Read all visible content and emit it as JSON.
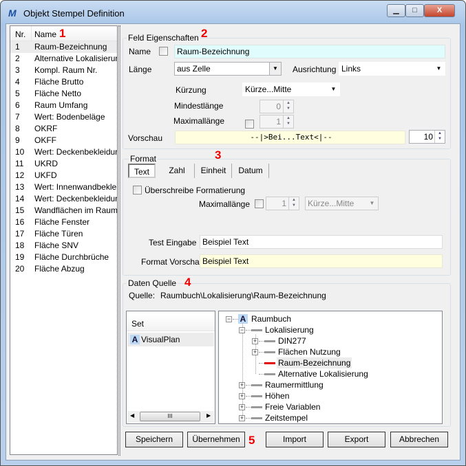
{
  "window": {
    "title": "Objekt Stempel Definition",
    "controls": [
      "minimize",
      "maximize",
      "close"
    ]
  },
  "list": {
    "col_nr": "Nr.",
    "col_name": "Name",
    "items": [
      {
        "nr": "1",
        "name": "Raum-Bezeichnung"
      },
      {
        "nr": "2",
        "name": "Alternative Lokalisierung"
      },
      {
        "nr": "3",
        "name": "Kompl. Raum Nr."
      },
      {
        "nr": "4",
        "name": "Fläche Brutto"
      },
      {
        "nr": "5",
        "name": "Fläche Netto"
      },
      {
        "nr": "6",
        "name": "Raum Umfang"
      },
      {
        "nr": "7",
        "name": "Wert: Bodenbeläge"
      },
      {
        "nr": "8",
        "name": "OKRF"
      },
      {
        "nr": "9",
        "name": "OKFF"
      },
      {
        "nr": "10",
        "name": "Wert: Deckenbekleidung"
      },
      {
        "nr": "11",
        "name": "UKRD"
      },
      {
        "nr": "12",
        "name": "UKFD"
      },
      {
        "nr": "13",
        "name": "Wert: Innenwandbekleidung"
      },
      {
        "nr": "14",
        "name": "Wert: Deckenbekleidung"
      },
      {
        "nr": "15",
        "name": "Wandflächen im Raum"
      },
      {
        "nr": "16",
        "name": "Fläche Fenster"
      },
      {
        "nr": "17",
        "name": "Fläche Türen"
      },
      {
        "nr": "18",
        "name": "Fläche SNV"
      },
      {
        "nr": "19",
        "name": "Fläche Durchbrüche"
      },
      {
        "nr": "20",
        "name": "Fläche Abzug"
      }
    ]
  },
  "annotations": {
    "a1": "1",
    "a2": "2",
    "a3": "3",
    "a4": "4",
    "a5": "5"
  },
  "feld": {
    "legend": "Feld Eigenschaften",
    "name_label": "Name",
    "name_value": "Raum-Bezeichnung",
    "laenge_label": "Länge",
    "laenge_value": "aus Zelle",
    "ausrichtung_label": "Ausrichtung",
    "ausrichtung_value": "Links",
    "kuerzung_label": "Kürzung",
    "kuerzung_value": "Kürze...Mitte",
    "mindest_label": "Mindestlänge",
    "mindest_value": "0",
    "maximal_label": "Maximallänge",
    "maximal_value": "1",
    "vorschau_label": "Vorschau",
    "vorschau_value": "--|>Bei...Text<|--",
    "vorschau_num": "10"
  },
  "format": {
    "legend": "Format",
    "tabs": [
      "Text",
      "Zahl",
      "Einheit",
      "Datum"
    ],
    "active_tab": "Text",
    "override_label": "Überschreibe Formatierung",
    "maximal_label": "Maximallänge",
    "maximal_value": "1",
    "kuerzung_value": "Kürze...Mitte",
    "test_label": "Test Eingabe",
    "test_value": "Beispiel Text",
    "vorschau_label": "Format Vorschau",
    "vorschau_value": "Beispiel Text"
  },
  "quelle": {
    "legend": "Daten Quelle",
    "label": "Quelle:",
    "path": "Raumbuch\\Lokalisierung\\Raum-Bezeichnung",
    "set_header": "Set",
    "set_item": "VisualPlan",
    "scroll_grip": "III",
    "tree": {
      "root": "Raumbuch",
      "lok": "Lokalisierung",
      "din": "DIN277",
      "flaechen": "Flächen Nutzung",
      "raum": "Raum-Bezeichnung",
      "alt": "Alternative Lokalisierung",
      "ermittlung": "Raumermittlung",
      "hoehen": "Höhen",
      "freie": "Freie Variablen",
      "zeit": "Zeitstempel"
    },
    "selected_color": "#e00000"
  },
  "buttons": {
    "save": "Speichern",
    "apply": "Übernehmen",
    "import": "Import",
    "export": "Export",
    "cancel": "Abbrechen"
  }
}
